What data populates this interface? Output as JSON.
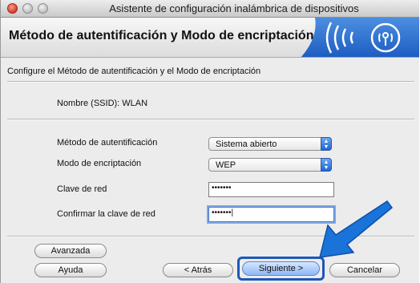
{
  "window": {
    "title": "Asistente de configuración inalámbrica de dispositivos"
  },
  "header": {
    "title": "Método de autentificación y Modo de encriptación",
    "logo_icon": "wireless-signal-icon"
  },
  "form": {
    "instruction": "Configure el Método de autentificación y el Modo de encriptación",
    "ssid_label": "Nombre (SSID): WLAN",
    "auth_method_label": "Método de autentificación",
    "auth_method_value": "Sistema abierto",
    "encryption_mode_label": "Modo de encriptación",
    "encryption_mode_value": "WEP",
    "network_key_label": "Clave de red",
    "network_key_value": "•••••••",
    "confirm_key_label": "Confirmar la clave de red",
    "confirm_key_value": "•••••••|"
  },
  "buttons": {
    "advanced": "Avanzada",
    "help": "Ayuda",
    "back": "< Atrás",
    "next": "Siguiente >",
    "cancel": "Cancelar"
  },
  "colors": {
    "highlight": "#1c58b8",
    "arrow": "#1a73d9"
  }
}
